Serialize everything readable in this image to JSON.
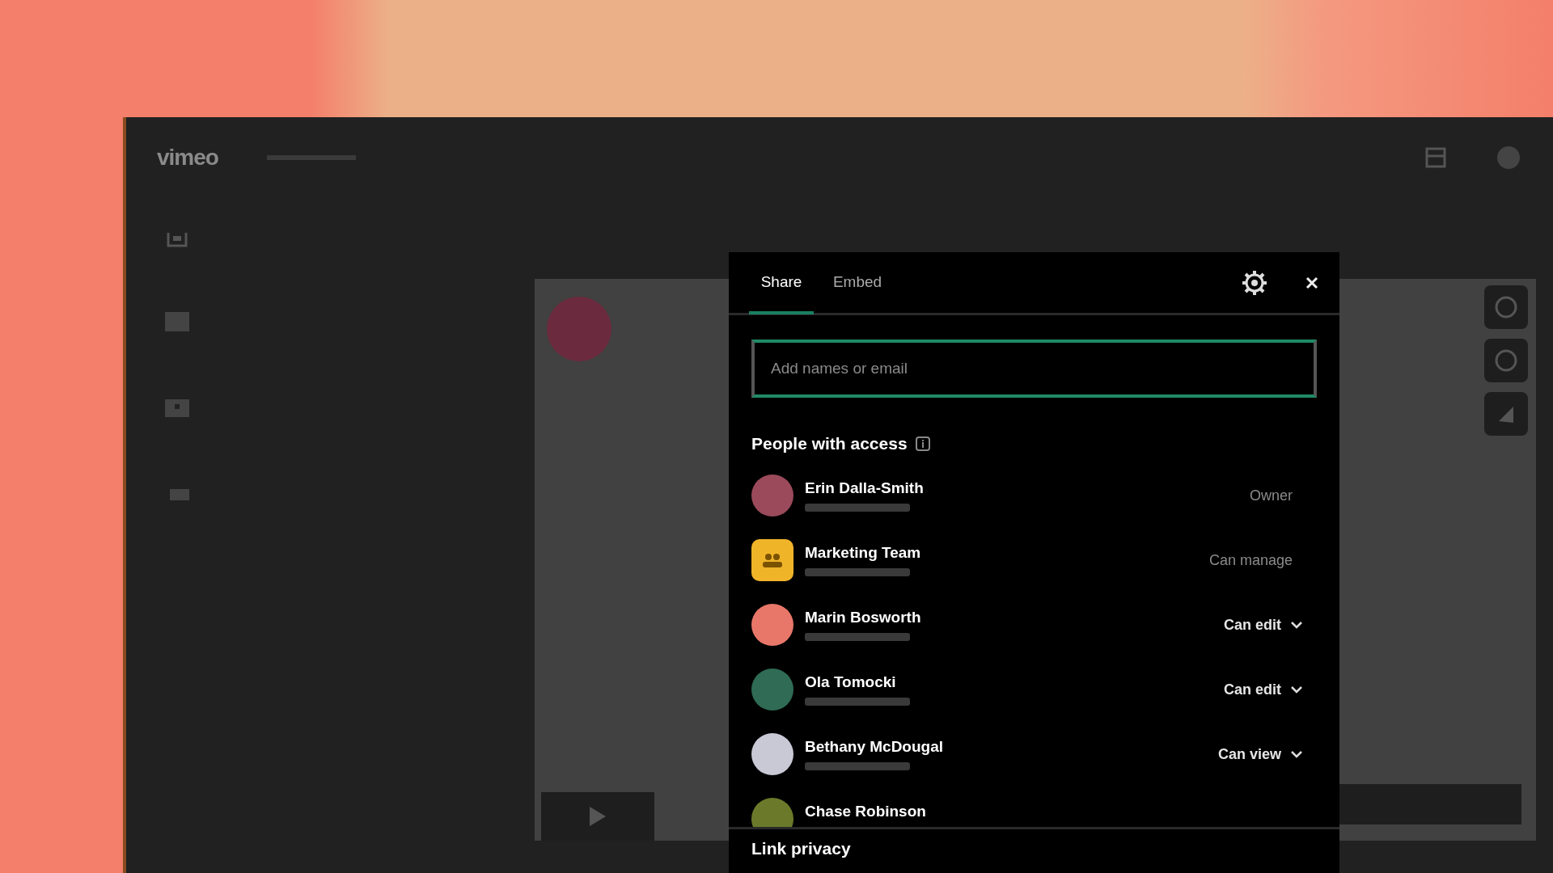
{
  "app": {
    "logo": "vimeo"
  },
  "dialog": {
    "tabs": [
      {
        "label": "Share",
        "selected": true
      },
      {
        "label": "Embed",
        "selected": false
      }
    ],
    "search": {
      "placeholder": "Add names or email"
    },
    "people_heading": "People with access",
    "people": [
      {
        "name": "Erin Dalla-Smith",
        "role": "Owner",
        "editable": false,
        "kind": "person",
        "color": "#9a4a5a"
      },
      {
        "name": "Marketing Team",
        "role": "Can manage",
        "editable": false,
        "kind": "team",
        "color": "#f0b429"
      },
      {
        "name": "Marin Bosworth",
        "role": "Can edit",
        "editable": true,
        "kind": "person",
        "color": "#e8776a"
      },
      {
        "name": "Ola Tomocki",
        "role": "Can edit",
        "editable": true,
        "kind": "person",
        "color": "#2f6b55"
      },
      {
        "name": "Bethany McDougal",
        "role": "Can view",
        "editable": true,
        "kind": "person",
        "color": "#c9c9d6"
      },
      {
        "name": "Chase Robinson",
        "kind": "person",
        "color": "#6a7a2a"
      }
    ],
    "link_heading": "Link privacy"
  }
}
